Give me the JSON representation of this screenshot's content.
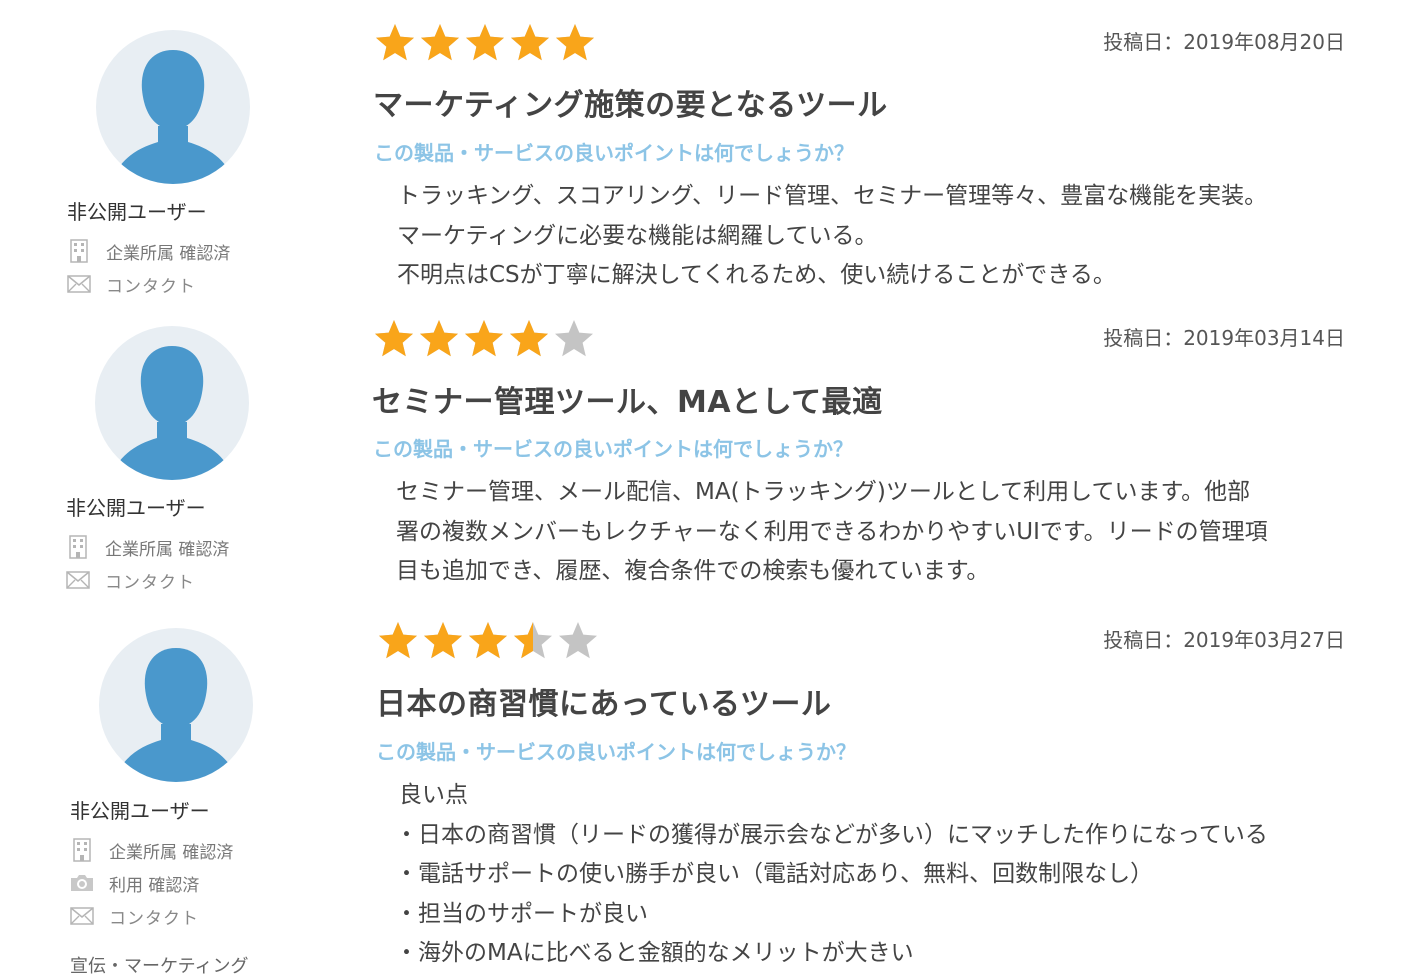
{
  "icons": {
    "building": "building-icon",
    "mail": "mail-icon",
    "camera": "camera-icon",
    "star": "star-icon",
    "avatar": "user-silhouette"
  },
  "colors": {
    "star_filled": "#f9a51a",
    "star_empty": "#c4c4c4",
    "question": "#8cc4e6",
    "avatar_bg": "#e8eef3",
    "avatar_fg": "#4a98cc"
  },
  "reviews": [
    {
      "rating": 5,
      "date": "投稿日：2019年08月20日",
      "title": "マーケティング施策の要となるツール",
      "question": "この製品・サービスの良いポイントは何でしょうか？",
      "body": [
        "トラッキング、スコアリング、リード管理、セミナー管理等々、豊富な機能を実装。",
        "マーケティングに必要な機能は網羅している。",
        "不明点はCSが丁寧に解決してくれるため、使い続けることができる。"
      ],
      "user": {
        "name": "非公開ユーザー",
        "company": "企業所属 確認済",
        "contact": "コンタクト"
      }
    },
    {
      "rating": 4,
      "date": "投稿日：2019年03月14日",
      "title": "セミナー管理ツール、MAとして最適",
      "question": "この製品・サービスの良いポイントは何でしょうか？",
      "body": [
        "セミナー管理、メール配信、MA(トラッキング)ツールとして利用しています。他部",
        "署の複数メンバーもレクチャーなく利用できるわかりやすいUIです。リードの管理項",
        "目も追加でき、履歴、複合条件での検索も優れています。"
      ],
      "user": {
        "name": "非公開ユーザー",
        "company": "企業所属 確認済",
        "contact": "コンタクト"
      }
    },
    {
      "rating": 3.5,
      "date": "投稿日：2019年03月27日",
      "title": "日本の商習慣にあっているツール",
      "question": "この製品・サービスの良いポイントは何でしょうか？",
      "body": [
        "良い点",
        "・日本の商習慣（リードの獲得が展示会などが多い）にマッチした作りになっている",
        "・電話サポートの使い勝手が良い（電話対応あり、無料、回数制限なし）",
        "・担当のサポートが良い",
        "・海外のMAに比べると金額的なメリットが大きい"
      ],
      "user": {
        "name": "非公開ユーザー",
        "company": "企業所属 確認済",
        "usage": "利用 確認済",
        "contact": "コンタクト",
        "department": "宣伝・マーケティング"
      }
    }
  ]
}
